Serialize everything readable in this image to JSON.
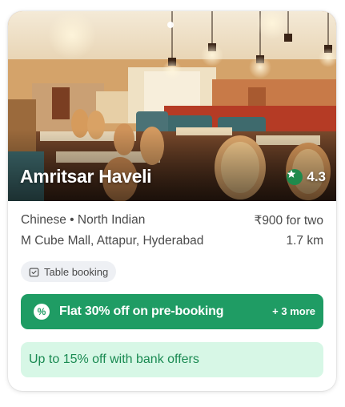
{
  "restaurant": {
    "name": "Amritsar Haveli",
    "rating": "4.3",
    "cuisines": "Chinese • North Indian",
    "price": "₹900 for two",
    "location": "M Cube Mall, Attapur, Hyderabad",
    "distance": "1.7 km"
  },
  "tags": {
    "table_booking": "Table booking"
  },
  "offers": {
    "primary": "Flat 30% off on pre-booking",
    "more": "+ 3 more",
    "bank": "Up to 15% off with bank offers"
  },
  "icons": {
    "rating": "star-icon",
    "table_booking": "calendar-check-icon",
    "offer": "percent-badge-icon"
  },
  "colors": {
    "offer_green": "#1f9c64",
    "bank_bg": "#d7f7e6",
    "rating_green": "#1f8a4c"
  }
}
